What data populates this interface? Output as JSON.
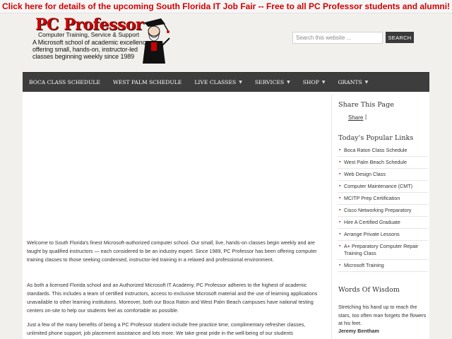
{
  "banner": {
    "text": "Click here for details of the upcoming South Florida IT Job Fair -- Free to all PC Professor students and alumni!"
  },
  "logo": {
    "title": "PC Professor",
    "subtitle": "Computer Training, Service & Support",
    "tagline_lines": [
      "A Microsoft school of academic excellence",
      "offering small, hands-on, instructor-led",
      "classes beginning weekly since 1989"
    ]
  },
  "search": {
    "placeholder": "Search this website ...",
    "button_label": "SEARCH"
  },
  "nav": {
    "items": [
      {
        "label": "BOCA CLASS SCHEDULE",
        "has_dropdown": false
      },
      {
        "label": "WEST PALM SCHEDULE",
        "has_dropdown": false
      },
      {
        "label": "LIVE CLASSES",
        "has_dropdown": true
      },
      {
        "label": "SERVICES",
        "has_dropdown": true
      },
      {
        "label": "SHOP",
        "has_dropdown": true
      },
      {
        "label": "GRANTS",
        "has_dropdown": true
      }
    ],
    "dropdown_icon": "caret-down-icon"
  },
  "main": {
    "paragraphs": [
      "Welcome to South Florida's finest Microsoft-authorized computer school. Our small, live, hands-on classes begin weekly and are taught by qualified instructors — each considered to be an industry expert.  Since 1989, PC Professor has been offering computer training classes to those seeking condensed, instructor-led training in a relaxed and professional environment.",
      "As both a licensed Florida school and an Authorized Microsoft IT Academy, PC Professor adheres to the highest of academic standards.  This includes a team of certified instructors, access to exclusive Microsoft material and the use of learning applications unavailable to other learning institutions.  Moreover, both our Boca Raton and West Palm Beach campuses have national testing centers on-site to help our students feel as comfortable as possible.",
      "Just a few of the many benefits of being a PC Professor student include free practice time, complimentary refresher classes, unlimited phone support, job placement assistance and lots more.  We take great pride in the well-being of our students"
    ]
  },
  "sidebar": {
    "share_title": "Share This Page",
    "share_link": "Share",
    "share_separator": "|",
    "popular_title": "Today's Popular Links",
    "popular_links": [
      "Boca Raton Class Schedule",
      "West Palm Beach Schedule",
      "Web Design Class",
      "Computer Maintenance (CMT)",
      "MCITP Prep Certification",
      "Cisco Networking Preparatory",
      "Hire A Certified Graduate",
      "Arrange Private Lessons",
      "A+ Preparatory Computer Repair Training Class",
      "Microsoft Training"
    ],
    "bullet_icon": "bullet-icon",
    "wisdom_title": "Words Of Wisdom",
    "quote": "Stretching his hand up to reach the stars, too often man forgets the flowers at his feet.",
    "quote_author": "Jeremy Bentham"
  },
  "colors": {
    "banner_text": "#d40000",
    "nav_bg": "#3d3d3d",
    "logo_red": "#cc0000",
    "page_bg": "#f1f0ec"
  }
}
